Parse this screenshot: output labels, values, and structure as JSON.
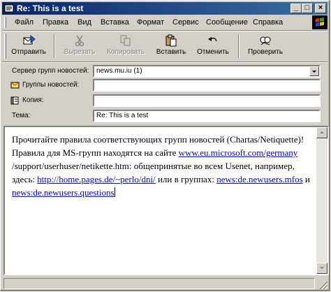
{
  "window": {
    "title": "Re: This is a test"
  },
  "menu": [
    "Файл",
    "Правка",
    "Вид",
    "Вставка",
    "Формат",
    "Сервис",
    "Сообщение",
    "Справка"
  ],
  "toolbar": {
    "send": "Отправить",
    "cut": "Вырезать",
    "copy": "Копировать",
    "paste": "Вставить",
    "undo": "Отменить",
    "check": "Проверить"
  },
  "header": {
    "server_label": "Сервер групп новостей:",
    "server_value": "news.mu.iu (1)",
    "groups_label": "Группы новостей:",
    "groups_value": "",
    "cc_label": "Копия:",
    "cc_value": "",
    "subject_label": "Тема:",
    "subject_value": "Re: This is a test"
  },
  "body": {
    "p1": "Прочитайте правила соответствующих групп новостей (Chartas/Netiquette)! Правила для MS-групп находятся на сайте ",
    "link1": "www.eu.microsoft.com/germany",
    "p2": " /support/userhuser/netikette.htm: общепринятые во всем Usenet, например, здесь: ",
    "link2": "http://home.pages.de/~perlo/dni/",
    "p3": " или в группах: ",
    "link3": "news:de.newusers.mfos",
    "p4": " и ",
    "link4": "news:de.newusers.questions"
  },
  "colors": {
    "title_bar": "#0a246a",
    "link": "#0000ff",
    "face": "#d4d0c8"
  },
  "icons": [
    "newsgroup-post-icon",
    "send-icon",
    "scissors-icon",
    "copy-icon",
    "paste-icon",
    "undo-icon",
    "spell-check-icon",
    "newsgroups-icon",
    "address-book-icon",
    "windows-logo-icon"
  ]
}
